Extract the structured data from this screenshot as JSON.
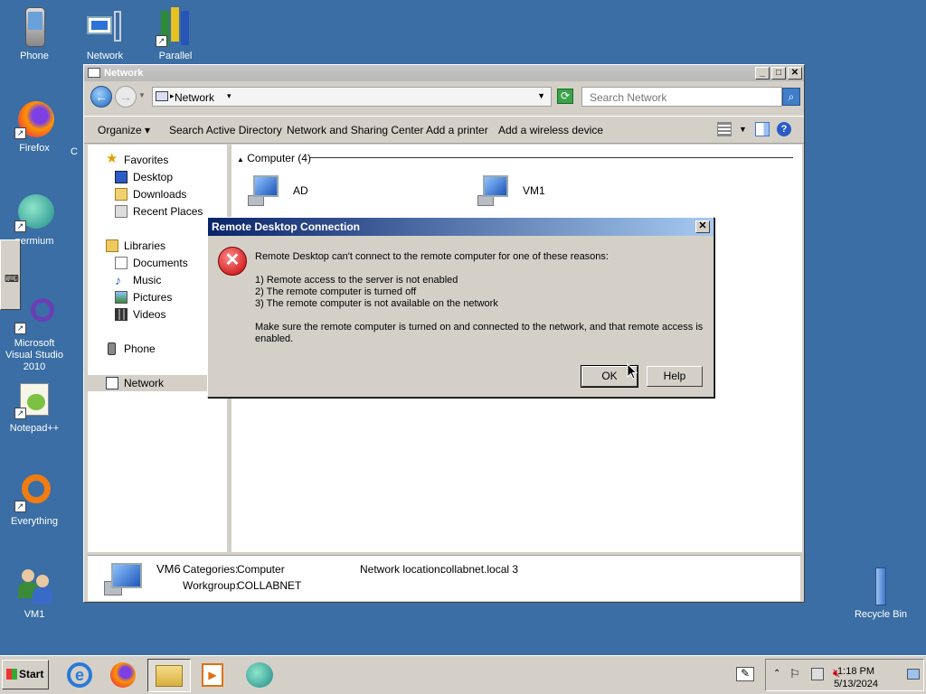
{
  "desktop": {
    "icons": [
      {
        "label": "Phone"
      },
      {
        "label": "Network"
      },
      {
        "label": "Parallel"
      },
      {
        "label": "Firefox"
      },
      {
        "label": "C"
      },
      {
        "label": "permium"
      },
      {
        "label": "Microsoft Visual Studio 2010"
      },
      {
        "label": "Notepad++"
      },
      {
        "label": "Everything"
      },
      {
        "label": "VM1"
      },
      {
        "label": "Recycle Bin"
      }
    ]
  },
  "explorer": {
    "title": "Network",
    "address": "Network",
    "search_placeholder": "Search Network",
    "commands": [
      "Organize",
      "Search Active Directory",
      "Network and Sharing Center",
      "Add a printer",
      "Add a wireless device"
    ],
    "nav": {
      "favorites": "Favorites",
      "desktop": "Desktop",
      "downloads": "Downloads",
      "recent": "Recent Places",
      "libraries": "Libraries",
      "documents": "Documents",
      "music": "Music",
      "pictures": "Pictures",
      "videos": "Videos",
      "phone": "Phone",
      "network": "Network"
    },
    "group_header": "Computer (4)",
    "computers": [
      "AD",
      "VM1"
    ],
    "details": {
      "name": "VM6",
      "categories_label": "Categories:",
      "categories_value": "Computer",
      "workgroup_label": "Workgroup:",
      "workgroup_value": "COLLABNET",
      "location_label": "Network location:",
      "location_value": "collabnet.local  3"
    }
  },
  "dialog": {
    "title": "Remote Desktop Connection",
    "line1": "Remote Desktop can't connect to the remote computer for one of these reasons:",
    "reason1": "1) Remote access to the server is not enabled",
    "reason2": "2) The remote computer is turned off",
    "reason3": "3) The remote computer is not available on the network",
    "line2a": "Make sure the remote computer is turned on and connected to the network, and that remote access is",
    "line2b": "enabled.",
    "ok": "OK",
    "help": "Help"
  },
  "taskbar": {
    "start": "Start",
    "time": "1:18 PM",
    "date": "5/13/2024"
  },
  "colors": {
    "desktop": "#3a6ea5",
    "dialog_title": "#0a246a",
    "error": "#c40000"
  }
}
